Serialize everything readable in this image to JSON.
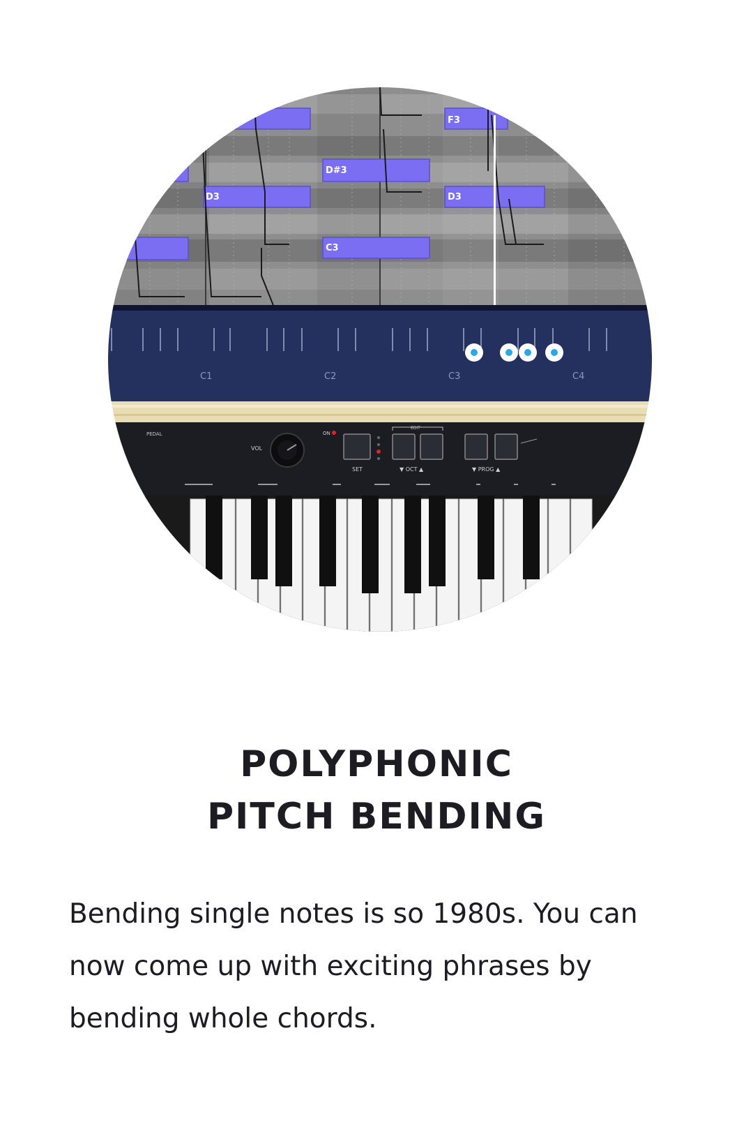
{
  "feature": {
    "title_line_1": "POLYPHONIC",
    "title_line_2": "PITCH BENDING",
    "description": "Bending single notes is so 1980s. You can now come up with exciting phrases by bending whole chords."
  },
  "piano_roll": {
    "notes": [
      {
        "label": "F3"
      },
      {
        "label": "D#3"
      },
      {
        "label": "D3"
      },
      {
        "label": "D3"
      },
      {
        "label": "C3"
      }
    ],
    "octave_labels": [
      "C1",
      "C2",
      "C3",
      "C4"
    ],
    "colors": {
      "note_fill": "#7b6ef2",
      "note_border": "#5a50c8",
      "grid_dark": "#6a6a6a",
      "grid_light": "#9a9a9a",
      "keyboard_panel": "#24305d",
      "pressed_key_dot": "#2aa8e8"
    }
  },
  "hardware": {
    "labels": {
      "pedal": "PEDAL",
      "volume": "VOL",
      "on": "ON",
      "set": "SET",
      "oct": "▼ OCT ▲",
      "prog": "▼ PROG ▲",
      "edit": "EDIT"
    },
    "colors": {
      "panel": "#1b1d22",
      "wood": "#e8ddb3",
      "white_key": "#f4f4f4",
      "black_key": "#101010",
      "led": "#e02424"
    }
  }
}
